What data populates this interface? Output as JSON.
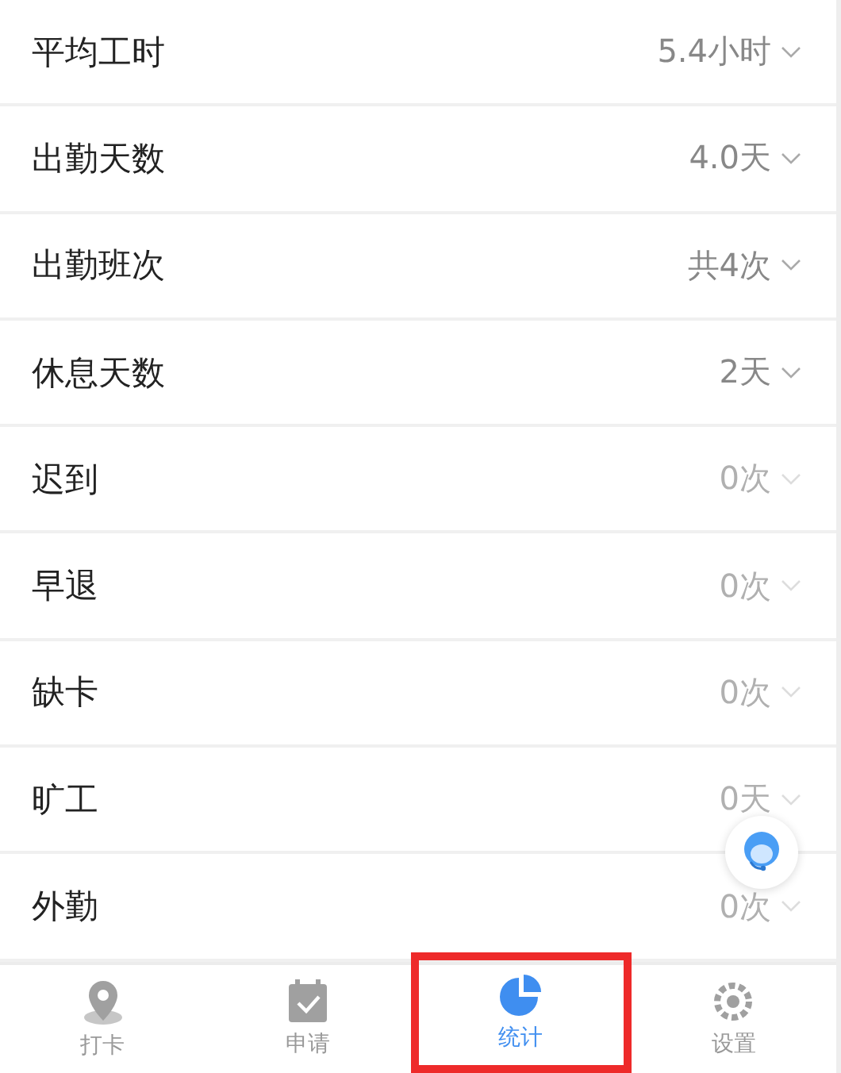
{
  "rows": [
    {
      "label": "平均工时",
      "value": "5.4小时",
      "dimmed": false
    },
    {
      "label": "出勤天数",
      "value": "4.0天",
      "dimmed": false
    },
    {
      "label": "出勤班次",
      "value": "共4次",
      "dimmed": false
    },
    {
      "label": "休息天数",
      "value": "2天",
      "dimmed": false
    },
    {
      "label": "迟到",
      "value": "0次",
      "dimmed": true
    },
    {
      "label": "早退",
      "value": "0次",
      "dimmed": true
    },
    {
      "label": "缺卡",
      "value": "0次",
      "dimmed": true
    },
    {
      "label": "旷工",
      "value": "0天",
      "dimmed": true
    },
    {
      "label": "外勤",
      "value": "0次",
      "dimmed": true
    }
  ],
  "tabs": [
    {
      "kind": "location",
      "label": "打卡",
      "selected": false,
      "highlighted": false
    },
    {
      "kind": "request",
      "label": "申请",
      "selected": false,
      "highlighted": false
    },
    {
      "kind": "stats",
      "label": "统计",
      "selected": true,
      "highlighted": true
    },
    {
      "kind": "settings",
      "label": "设置",
      "selected": false,
      "highlighted": false
    }
  ]
}
